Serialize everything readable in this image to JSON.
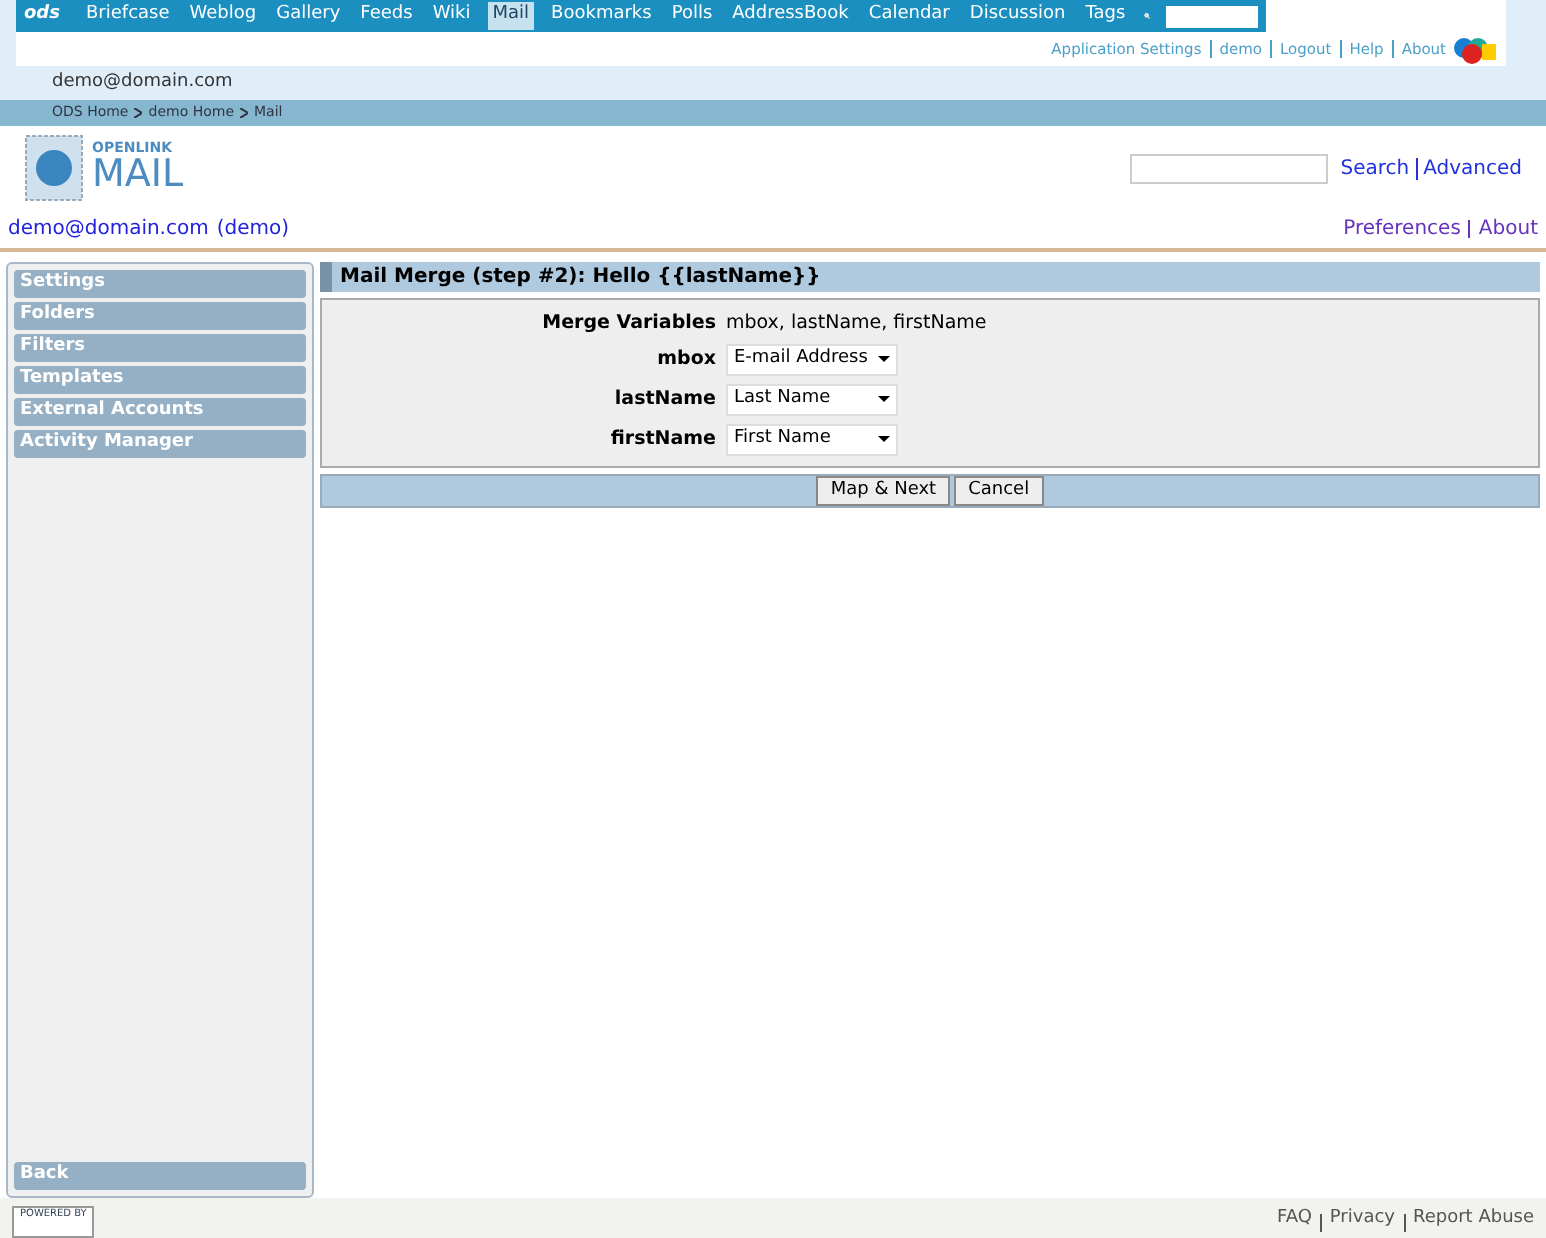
{
  "nav": {
    "logo": "ods",
    "items": [
      {
        "label": "Briefcase",
        "selected": false
      },
      {
        "label": "Weblog",
        "selected": false
      },
      {
        "label": "Gallery",
        "selected": false
      },
      {
        "label": "Feeds",
        "selected": false
      },
      {
        "label": "Wiki",
        "selected": false
      },
      {
        "label": "Mail",
        "selected": true
      },
      {
        "label": "Bookmarks",
        "selected": false
      },
      {
        "label": "Polls",
        "selected": false
      },
      {
        "label": "AddressBook",
        "selected": false
      },
      {
        "label": "Calendar",
        "selected": false
      },
      {
        "label": "Discussion",
        "selected": false
      },
      {
        "label": "Tags",
        "selected": false
      }
    ]
  },
  "top_links": [
    "Application Settings",
    "demo",
    "Logout",
    "Help",
    "About"
  ],
  "user_email": "demo@domain.com",
  "breadcrumb": [
    "ODS Home",
    "demo Home",
    "Mail"
  ],
  "app_logo": {
    "brand": "OPENLINK",
    "product": "MAIL"
  },
  "search": {
    "button": "Search",
    "advanced": "Advanced"
  },
  "account": {
    "email": "demo@domain.com",
    "user": "(demo)"
  },
  "header_links": [
    "Preferences",
    "About"
  ],
  "sidebar": {
    "items": [
      "Settings",
      "Folders",
      "Filters",
      "Templates",
      "External Accounts",
      "Activity Manager"
    ],
    "back": "Back"
  },
  "panel": {
    "title": "Mail Merge (step #2): Hello {{lastName}}",
    "merge_label": "Merge Variables",
    "merge_value": "mbox, lastName, firstName",
    "fields": [
      {
        "label": "mbox",
        "value": "E-mail Address"
      },
      {
        "label": "lastName",
        "value": "Last Name"
      },
      {
        "label": "firstName",
        "value": "First Name"
      }
    ],
    "buttons": [
      "Map & Next",
      "Cancel"
    ]
  },
  "footer": {
    "powered": "POWERED BY",
    "links": [
      "FAQ",
      "Privacy",
      "Report Abuse"
    ]
  }
}
